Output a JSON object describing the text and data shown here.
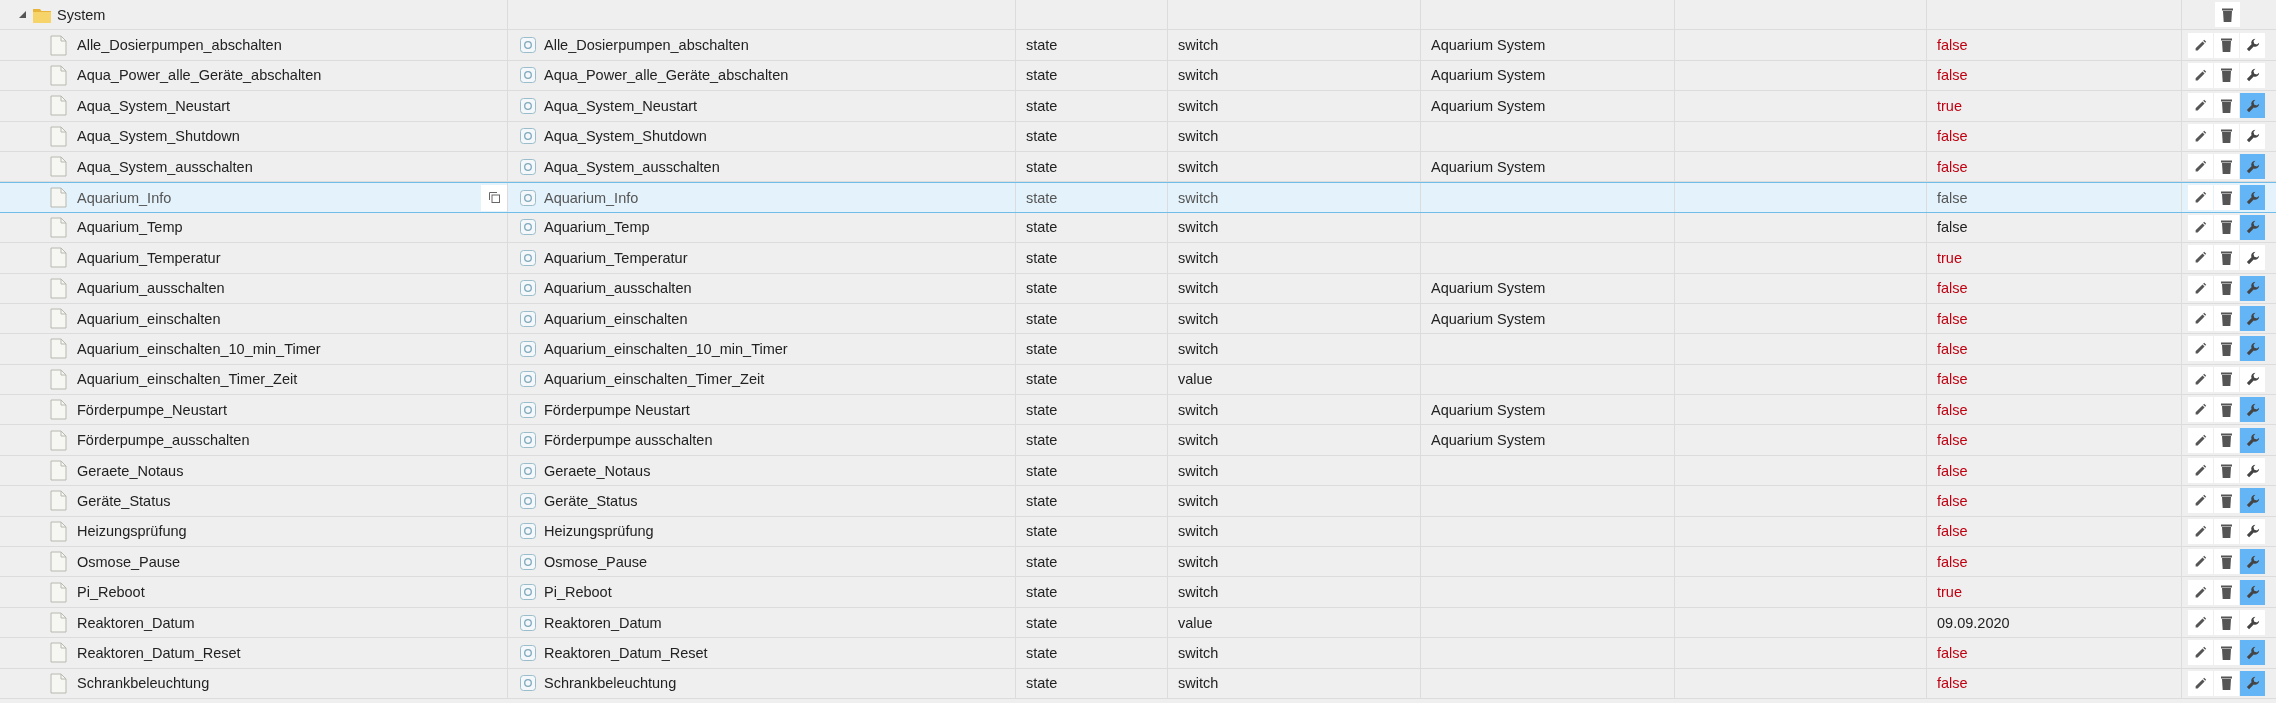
{
  "folder": {
    "name": "System",
    "expanded": true
  },
  "rows": [
    {
      "id": "Alle_Dosierpumpen_abschalten",
      "name": "Alle_Dosierpumpen_abschalten",
      "type": "state",
      "role": "switch",
      "room": "Aquarium System",
      "value": "false",
      "ack": false,
      "custom": false,
      "selected": false
    },
    {
      "id": "Aqua_Power_alle_Geräte_abschalten",
      "name": "Aqua_Power_alle_Geräte_abschalten",
      "type": "state",
      "role": "switch",
      "room": "Aquarium System",
      "value": "false",
      "ack": false,
      "custom": false,
      "selected": false
    },
    {
      "id": "Aqua_System_Neustart",
      "name": "Aqua_System_Neustart",
      "type": "state",
      "role": "switch",
      "room": "Aquarium System",
      "value": "true",
      "ack": false,
      "custom": true,
      "selected": false
    },
    {
      "id": "Aqua_System_Shutdown",
      "name": "Aqua_System_Shutdown",
      "type": "state",
      "role": "switch",
      "value": "false",
      "ack": false,
      "custom": false,
      "selected": false
    },
    {
      "id": "Aqua_System_ausschalten",
      "name": "Aqua_System_ausschalten",
      "type": "state",
      "role": "switch",
      "room": "Aquarium System",
      "value": "false",
      "ack": false,
      "custom": true,
      "selected": false
    },
    {
      "id": "Aquarium_Info",
      "name": "Aquarium_Info",
      "type": "state",
      "role": "switch",
      "value": "false",
      "ack": true,
      "custom": true,
      "selected": true
    },
    {
      "id": "Aquarium_Temp",
      "name": "Aquarium_Temp",
      "type": "state",
      "role": "switch",
      "value": "false",
      "ack": true,
      "custom": true,
      "selected": false
    },
    {
      "id": "Aquarium_Temperatur",
      "name": "Aquarium_Temperatur",
      "type": "state",
      "role": "switch",
      "value": "true",
      "ack": false,
      "custom": false,
      "selected": false
    },
    {
      "id": "Aquarium_ausschalten",
      "name": "Aquarium_ausschalten",
      "type": "state",
      "role": "switch",
      "room": "Aquarium System",
      "value": "false",
      "ack": false,
      "custom": true,
      "selected": false
    },
    {
      "id": "Aquarium_einschalten",
      "name": "Aquarium_einschalten",
      "type": "state",
      "role": "switch",
      "room": "Aquarium System",
      "value": "false",
      "ack": false,
      "custom": true,
      "selected": false
    },
    {
      "id": "Aquarium_einschalten_10_min_Timer",
      "name": "Aquarium_einschalten_10_min_Timer",
      "type": "state",
      "role": "switch",
      "value": "false",
      "ack": false,
      "custom": true,
      "selected": false
    },
    {
      "id": "Aquarium_einschalten_Timer_Zeit",
      "name": "Aquarium_einschalten_Timer_Zeit",
      "type": "state",
      "role": "value",
      "value": "false",
      "ack": false,
      "custom": false,
      "selected": false
    },
    {
      "id": "Förderpumpe_Neustart",
      "name": "Förderpumpe Neustart",
      "type": "state",
      "role": "switch",
      "room": "Aquarium System",
      "value": "false",
      "ack": false,
      "custom": true,
      "selected": false
    },
    {
      "id": "Förderpumpe_ausschalten",
      "name": "Förderpumpe ausschalten",
      "type": "state",
      "role": "switch",
      "room": "Aquarium System",
      "value": "false",
      "ack": false,
      "custom": true,
      "selected": false
    },
    {
      "id": "Geraete_Notaus",
      "name": "Geraete_Notaus",
      "type": "state",
      "role": "switch",
      "value": "false",
      "ack": false,
      "custom": false,
      "selected": false
    },
    {
      "id": "Geräte_Status",
      "name": "Geräte_Status",
      "type": "state",
      "role": "switch",
      "value": "false",
      "ack": false,
      "custom": true,
      "selected": false
    },
    {
      "id": "Heizungsprüfung",
      "name": "Heizungsprüfung",
      "type": "state",
      "role": "switch",
      "value": "false",
      "ack": false,
      "custom": false,
      "selected": false
    },
    {
      "id": "Osmose_Pause",
      "name": "Osmose_Pause",
      "type": "state",
      "role": "switch",
      "value": "false",
      "ack": false,
      "custom": true,
      "selected": false
    },
    {
      "id": "Pi_Reboot",
      "name": "Pi_Reboot",
      "type": "state",
      "role": "switch",
      "value": "true",
      "ack": false,
      "custom": true,
      "selected": false
    },
    {
      "id": "Reaktoren_Datum",
      "name": "Reaktoren_Datum",
      "type": "state",
      "role": "value",
      "value": "09.09.2020",
      "ack": true,
      "custom": false,
      "selected": false
    },
    {
      "id": "Reaktoren_Datum_Reset",
      "name": "Reaktoren_Datum_Reset",
      "type": "state",
      "role": "switch",
      "value": "false",
      "ack": false,
      "custom": true,
      "selected": false
    },
    {
      "id": "Schrankbeleuchtung",
      "name": "Schrankbeleuchtung",
      "type": "state",
      "role": "switch",
      "value": "false",
      "ack": false,
      "custom": true,
      "selected": false
    }
  ]
}
